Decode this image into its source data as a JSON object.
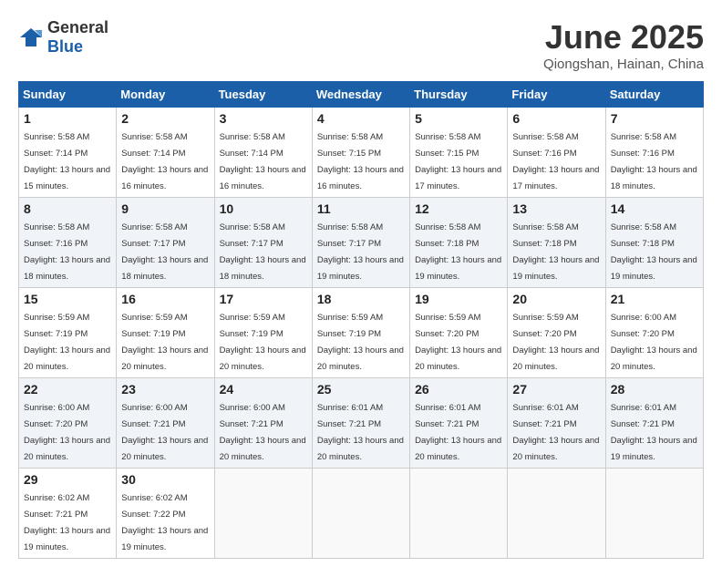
{
  "header": {
    "logo_general": "General",
    "logo_blue": "Blue",
    "month": "June 2025",
    "location": "Qiongshan, Hainan, China"
  },
  "weekdays": [
    "Sunday",
    "Monday",
    "Tuesday",
    "Wednesday",
    "Thursday",
    "Friday",
    "Saturday"
  ],
  "weeks": [
    [
      {
        "day": "1",
        "sunrise": "5:58 AM",
        "sunset": "7:14 PM",
        "daylight": "13 hours and 15 minutes."
      },
      {
        "day": "2",
        "sunrise": "5:58 AM",
        "sunset": "7:14 PM",
        "daylight": "13 hours and 16 minutes."
      },
      {
        "day": "3",
        "sunrise": "5:58 AM",
        "sunset": "7:14 PM",
        "daylight": "13 hours and 16 minutes."
      },
      {
        "day": "4",
        "sunrise": "5:58 AM",
        "sunset": "7:15 PM",
        "daylight": "13 hours and 16 minutes."
      },
      {
        "day": "5",
        "sunrise": "5:58 AM",
        "sunset": "7:15 PM",
        "daylight": "13 hours and 17 minutes."
      },
      {
        "day": "6",
        "sunrise": "5:58 AM",
        "sunset": "7:16 PM",
        "daylight": "13 hours and 17 minutes."
      },
      {
        "day": "7",
        "sunrise": "5:58 AM",
        "sunset": "7:16 PM",
        "daylight": "13 hours and 18 minutes."
      }
    ],
    [
      {
        "day": "8",
        "sunrise": "5:58 AM",
        "sunset": "7:16 PM",
        "daylight": "13 hours and 18 minutes."
      },
      {
        "day": "9",
        "sunrise": "5:58 AM",
        "sunset": "7:17 PM",
        "daylight": "13 hours and 18 minutes."
      },
      {
        "day": "10",
        "sunrise": "5:58 AM",
        "sunset": "7:17 PM",
        "daylight": "13 hours and 18 minutes."
      },
      {
        "day": "11",
        "sunrise": "5:58 AM",
        "sunset": "7:17 PM",
        "daylight": "13 hours and 19 minutes."
      },
      {
        "day": "12",
        "sunrise": "5:58 AM",
        "sunset": "7:18 PM",
        "daylight": "13 hours and 19 minutes."
      },
      {
        "day": "13",
        "sunrise": "5:58 AM",
        "sunset": "7:18 PM",
        "daylight": "13 hours and 19 minutes."
      },
      {
        "day": "14",
        "sunrise": "5:58 AM",
        "sunset": "7:18 PM",
        "daylight": "13 hours and 19 minutes."
      }
    ],
    [
      {
        "day": "15",
        "sunrise": "5:59 AM",
        "sunset": "7:19 PM",
        "daylight": "13 hours and 20 minutes."
      },
      {
        "day": "16",
        "sunrise": "5:59 AM",
        "sunset": "7:19 PM",
        "daylight": "13 hours and 20 minutes."
      },
      {
        "day": "17",
        "sunrise": "5:59 AM",
        "sunset": "7:19 PM",
        "daylight": "13 hours and 20 minutes."
      },
      {
        "day": "18",
        "sunrise": "5:59 AM",
        "sunset": "7:19 PM",
        "daylight": "13 hours and 20 minutes."
      },
      {
        "day": "19",
        "sunrise": "5:59 AM",
        "sunset": "7:20 PM",
        "daylight": "13 hours and 20 minutes."
      },
      {
        "day": "20",
        "sunrise": "5:59 AM",
        "sunset": "7:20 PM",
        "daylight": "13 hours and 20 minutes."
      },
      {
        "day": "21",
        "sunrise": "6:00 AM",
        "sunset": "7:20 PM",
        "daylight": "13 hours and 20 minutes."
      }
    ],
    [
      {
        "day": "22",
        "sunrise": "6:00 AM",
        "sunset": "7:20 PM",
        "daylight": "13 hours and 20 minutes."
      },
      {
        "day": "23",
        "sunrise": "6:00 AM",
        "sunset": "7:21 PM",
        "daylight": "13 hours and 20 minutes."
      },
      {
        "day": "24",
        "sunrise": "6:00 AM",
        "sunset": "7:21 PM",
        "daylight": "13 hours and 20 minutes."
      },
      {
        "day": "25",
        "sunrise": "6:01 AM",
        "sunset": "7:21 PM",
        "daylight": "13 hours and 20 minutes."
      },
      {
        "day": "26",
        "sunrise": "6:01 AM",
        "sunset": "7:21 PM",
        "daylight": "13 hours and 20 minutes."
      },
      {
        "day": "27",
        "sunrise": "6:01 AM",
        "sunset": "7:21 PM",
        "daylight": "13 hours and 20 minutes."
      },
      {
        "day": "28",
        "sunrise": "6:01 AM",
        "sunset": "7:21 PM",
        "daylight": "13 hours and 19 minutes."
      }
    ],
    [
      {
        "day": "29",
        "sunrise": "6:02 AM",
        "sunset": "7:21 PM",
        "daylight": "13 hours and 19 minutes."
      },
      {
        "day": "30",
        "sunrise": "6:02 AM",
        "sunset": "7:22 PM",
        "daylight": "13 hours and 19 minutes."
      },
      null,
      null,
      null,
      null,
      null
    ]
  ]
}
